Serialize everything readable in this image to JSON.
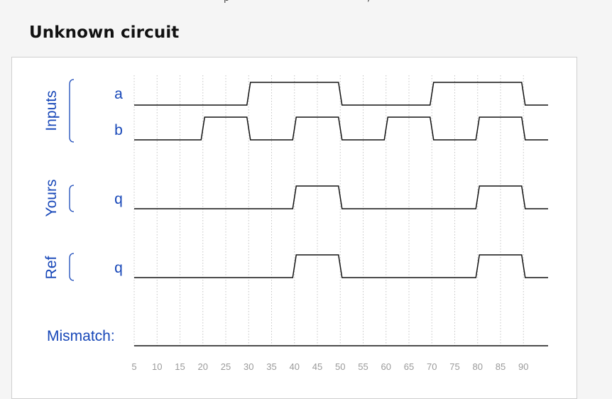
{
  "header": {
    "top_fragment_left": "p",
    "top_fragment_right": ",",
    "title": "Unknown circuit"
  },
  "waveform": {
    "groups": [
      {
        "label": "Inputs",
        "signals": [
          {
            "name": "a",
            "edges": [
              [
                0,
                0
              ],
              [
                30,
                1
              ],
              [
                50,
                0
              ],
              [
                70,
                1
              ],
              [
                90,
                0
              ]
            ]
          },
          {
            "name": "b",
            "edges": [
              [
                0,
                0
              ],
              [
                20,
                1
              ],
              [
                30,
                0
              ],
              [
                40,
                1
              ],
              [
                50,
                0
              ],
              [
                60,
                1
              ],
              [
                70,
                0
              ],
              [
                80,
                1
              ],
              [
                90,
                0
              ]
            ]
          }
        ]
      },
      {
        "label": "Yours",
        "signals": [
          {
            "name": "q",
            "edges": [
              [
                0,
                0
              ],
              [
                40,
                1
              ],
              [
                50,
                0
              ],
              [
                80,
                1
              ],
              [
                90,
                0
              ]
            ]
          }
        ]
      },
      {
        "label": "Ref",
        "signals": [
          {
            "name": "q",
            "edges": [
              [
                0,
                0
              ],
              [
                40,
                1
              ],
              [
                50,
                0
              ],
              [
                80,
                1
              ],
              [
                90,
                0
              ]
            ]
          }
        ]
      }
    ],
    "mismatch_label": "Mismatch:",
    "mismatch_edges": [
      [
        0,
        0
      ]
    ],
    "ticks": [
      5,
      10,
      15,
      20,
      25,
      30,
      35,
      40,
      45,
      50,
      55,
      60,
      65,
      70,
      75,
      80,
      85,
      90
    ],
    "time_range": [
      5,
      95
    ],
    "colors": {
      "label": "#1747b8",
      "trace": "#111111",
      "grid": "#c4c4c4",
      "tick": "#9a9a9a"
    }
  }
}
